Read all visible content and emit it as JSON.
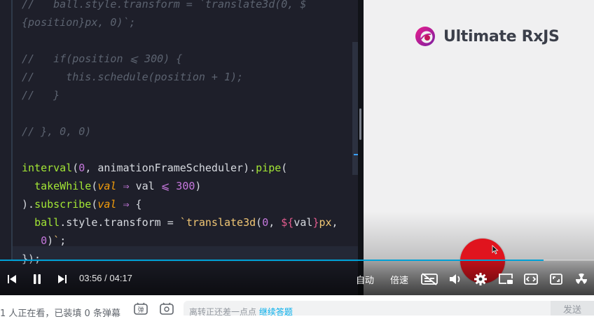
{
  "code": {
    "lines": [
      "//   ball.style.transform = `translate3d(0, $",
      "{position}px, 0)`;",
      "//   if(position ⩽ 300) {",
      "//     this.schedule(position + 1);",
      "//   }",
      "// }, 0, 0)",
      "interval(0, animationFrameScheduler).pipe(",
      "  takeWhile(val ⇒ val ⩽ 300)",
      ").subscribe(val ⇒ {",
      "  ball.style.transform = `translate3d(0, ${val}px,",
      "   0)`;",
      "});"
    ]
  },
  "slide": {
    "logo_text": "Ultimate RxJS"
  },
  "player": {
    "time": "03:56 / 04:17",
    "progress": 0.915,
    "quality_label": "自动",
    "speed_label": "倍速",
    "icons": [
      "prev-icon",
      "pause-icon",
      "next-icon",
      "subtitle-off-icon",
      "volume-icon",
      "settings-icon",
      "pip-icon",
      "widescreen-icon",
      "fullscreen-icon",
      "radiation-icon"
    ]
  },
  "bottom": {
    "viewers_text": "1 人正在看，已装填 0 条弹幕",
    "placeholder_prefix": "离转正还差一点点 ",
    "placeholder_link": "继续答题",
    "send_label": "发送"
  },
  "colors": {
    "accent": "#00a1d6",
    "ball": "#e0141e"
  }
}
